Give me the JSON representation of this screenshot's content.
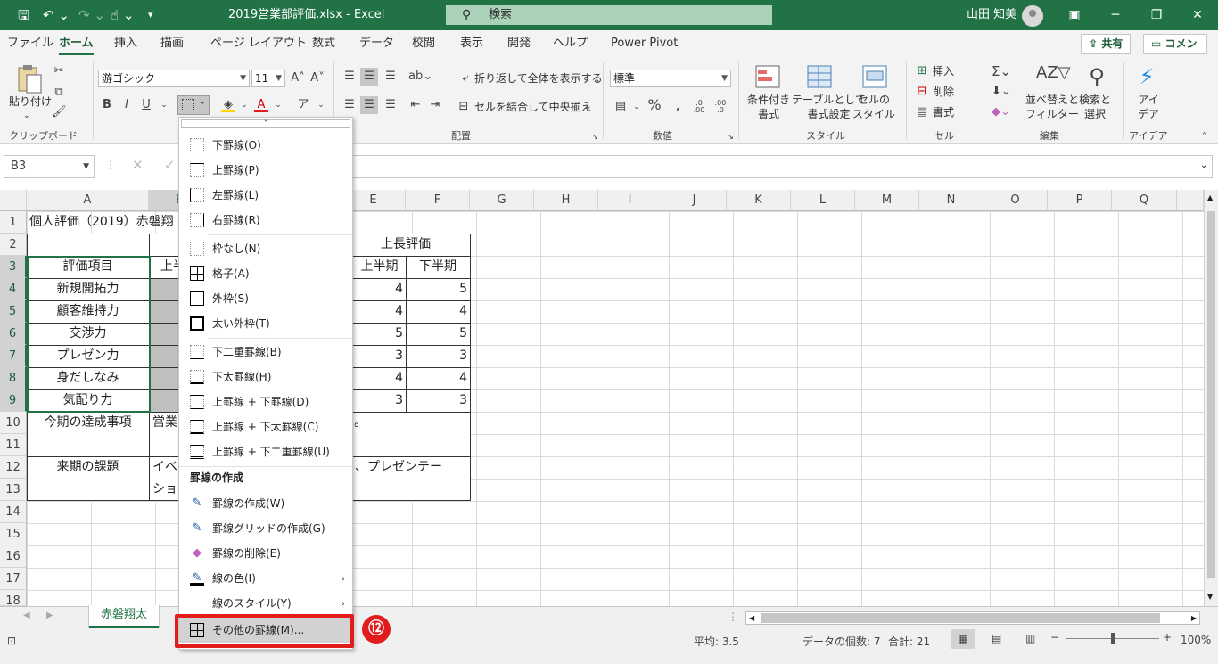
{
  "window": {
    "title": "2019営業部評価.xlsx  -  Excel",
    "search_placeholder": "検索",
    "user": "山田 知美"
  },
  "tabs": [
    "ファイル",
    "ホーム",
    "挿入",
    "描画",
    "ページ レイアウト",
    "数式",
    "データ",
    "校閲",
    "表示",
    "開発",
    "ヘルプ",
    "Power Pivot"
  ],
  "share": {
    "share_label": "共有",
    "comment_label": "コメント"
  },
  "ribbon": {
    "paste": "貼り付け",
    "font_name": "游ゴシック",
    "font_size": "11",
    "wrap_text": "折り返して全体を表示する",
    "merge_center": "セルを結合して中央揃え",
    "number_format": "標準",
    "cond_format": "条件付き\n書式",
    "table_format": "テーブルとして\n書式設定",
    "cell_styles": "セルの\nスタイル",
    "insert": "挿入",
    "delete": "削除",
    "format": "書式",
    "sort_filter": "並べ替えと\nフィルター",
    "find_select": "検索と\n選択",
    "ideas": "アイ\nデア",
    "groups": {
      "clipboard": "クリップボード",
      "alignment": "配置",
      "number": "数値",
      "styles": "スタイル",
      "cells": "セル",
      "editing": "編集",
      "ideas": "アイデア"
    }
  },
  "namebox": "B3",
  "columns": [
    "A",
    "B",
    "C",
    "D",
    "E",
    "F",
    "G",
    "H",
    "I",
    "J",
    "K",
    "L",
    "M",
    "N",
    "O",
    "P",
    "Q"
  ],
  "rows": [
    "1",
    "2",
    "3",
    "4",
    "5",
    "6",
    "7",
    "8",
    "9",
    "10",
    "11",
    "12",
    "13",
    "14",
    "15",
    "16",
    "17",
    "18"
  ],
  "cells": {
    "A1": "個人評価（2019）赤磐翔",
    "E2": "上長評価",
    "A3": "評価項目",
    "B3": "上半",
    "E3": "上半期",
    "F3": "下半期",
    "A4": "新規開拓力",
    "E4": "4",
    "F4": "5",
    "A5": "顧客維持力",
    "E5": "4",
    "F5": "4",
    "A6": "交渉力",
    "E6": "5",
    "F6": "5",
    "A7": "プレゼン力",
    "E7": "3",
    "F7": "3",
    "A8": "身だしなみ",
    "E8": "4",
    "F8": "4",
    "A9": "気配り力",
    "E9": "3",
    "F9": "3",
    "A10": "今期の達成事項",
    "B10": "営業",
    "D10": "。",
    "A12": "来期の課題",
    "B12": "イベ",
    "D12": "、プレゼンテー",
    "B13": "ショ"
  },
  "sheet_tab": "赤磐翔太",
  "status": {
    "average": "平均: 3.5",
    "count": "データの個数: 7",
    "sum": "合計: 21",
    "zoom": "100%"
  },
  "border_menu": {
    "items": [
      {
        "label": "下罫線(O)"
      },
      {
        "label": "上罫線(P)"
      },
      {
        "label": "左罫線(L)"
      },
      {
        "label": "右罫線(R)"
      },
      {
        "label": "枠なし(N)"
      },
      {
        "label": "格子(A)"
      },
      {
        "label": "外枠(S)"
      },
      {
        "label": "太い外枠(T)"
      },
      {
        "label": "下二重罫線(B)"
      },
      {
        "label": "下太罫線(H)"
      },
      {
        "label": "上罫線 + 下罫線(D)"
      },
      {
        "label": "上罫線 + 下太罫線(C)"
      },
      {
        "label": "上罫線 + 下二重罫線(U)"
      }
    ],
    "draw_heading": "罫線の作成",
    "draw_items": [
      {
        "label": "罫線の作成(W)"
      },
      {
        "label": "罫線グリッドの作成(G)"
      },
      {
        "label": "罫線の削除(E)"
      },
      {
        "label": "線の色(I)"
      },
      {
        "label": "線のスタイル(Y)"
      },
      {
        "label": "その他の罫線(M)..."
      }
    ]
  },
  "callout": "⑫",
  "colors": {
    "accent": "#217346",
    "highlight": "#e01c1c"
  }
}
